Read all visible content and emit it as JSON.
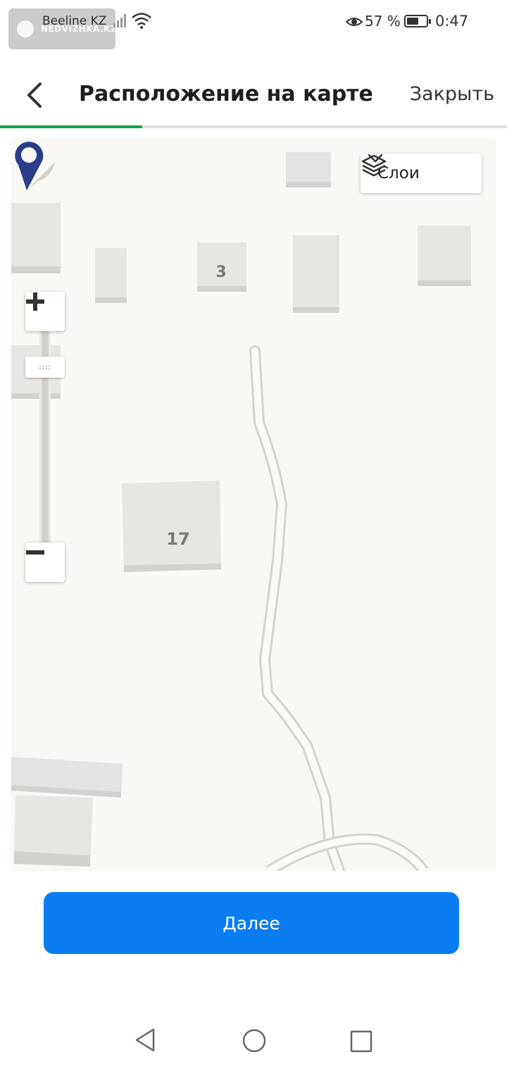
{
  "status_bar": {
    "carrier": "Beeline KZ",
    "watermark": "NEDVIZHKA.KZ",
    "battery_percent": "57 %",
    "time": "0:47",
    "icons": [
      "signal-icon",
      "wifi-icon",
      "eye-icon",
      "battery-icon"
    ]
  },
  "header": {
    "back_icon": "chevron-left-icon",
    "title": "Расположение на карте",
    "close_label": "Закрыть",
    "progress_fraction": 0.28,
    "progress_color": "#17a34a"
  },
  "map": {
    "layers_button": {
      "icon": "layers-icon",
      "label": "Слои",
      "chevron": "chevron-down-icon"
    },
    "zoom": {
      "plus_icon": "plus-icon",
      "minus_icon": "minus-icon",
      "handle_text": "::::"
    },
    "building_labels": [
      "3",
      "17"
    ],
    "marker": {
      "icon": "map-pin-icon",
      "color": "#2c3e8a"
    }
  },
  "footer": {
    "next_label": "Далее",
    "next_color": "#0a7df2"
  },
  "system_nav": {
    "icons": [
      "nav-back-icon",
      "nav-home-icon",
      "nav-recents-icon"
    ]
  }
}
